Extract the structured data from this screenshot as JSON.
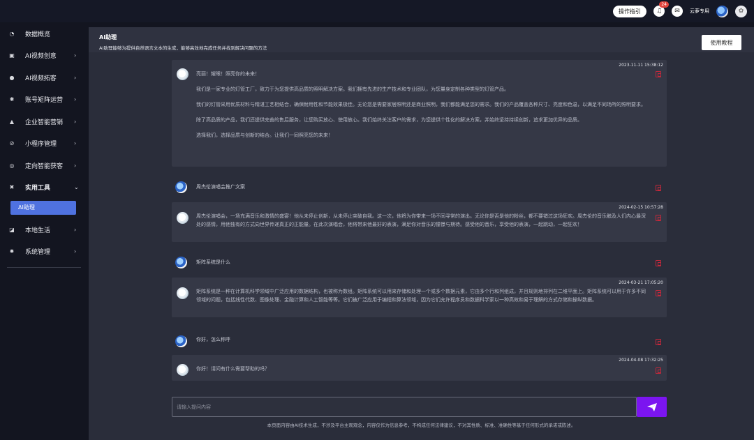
{
  "topbar": {
    "guide_label": "操作指引",
    "notification_count": "24",
    "account_label": "云萝专用"
  },
  "sidebar": {
    "items": [
      {
        "label": "数据概览",
        "icon": "dashboard-icon",
        "glyph": "◔"
      },
      {
        "label": "AI视频创意",
        "icon": "video-icon",
        "glyph": "▣"
      },
      {
        "label": "AI视频拓客",
        "icon": "target-icon",
        "glyph": "●"
      },
      {
        "label": "账号矩阵运营",
        "icon": "grid-icon",
        "glyph": "✱"
      },
      {
        "label": "企业智能营销",
        "icon": "chart-icon",
        "glyph": "▲"
      },
      {
        "label": "小程序管理",
        "icon": "miniapp-icon",
        "glyph": "⊘"
      },
      {
        "label": "定向智能获客",
        "icon": "radar-icon",
        "glyph": "◎"
      },
      {
        "label": "实用工具",
        "icon": "tools-icon",
        "glyph": "✖"
      },
      {
        "label": "本地生活",
        "icon": "local-icon",
        "glyph": "◪"
      },
      {
        "label": "系统管理",
        "icon": "settings-icon",
        "glyph": "✹"
      }
    ],
    "active_sub": "AI助理"
  },
  "header": {
    "title": "AI助理",
    "subtitle": "AI助理能够为提供自然语言文本的生成，能够高效地完成任务并找到解决问题的方法",
    "tutorial_button": "使用教程"
  },
  "chat": {
    "m1": {
      "time": "2023-11-11 15:38:12",
      "paragraphs": [
        "亮丽！耀眼！照亮你的未来！",
        "我们是一家专业的灯管工厂，致力于为您提供高品质的照明解决方案。我们拥有先进的生产技术和专业团队，为您量身定制各种类型的灯管产品。",
        "我们的灯管采用优质材料与精湛工艺相结合，确保耐用性和节能效果极佳。无论您是需要家居照明还是商业照明，我们都能满足您的需求。我们的产品覆盖各种尺寸、亮度和色温，以满足不同场所的照明要求。",
        "除了高品质的产品，我们还提供完善的售后服务，让您购买放心、使用放心。我们始终关注客户的需求，为您提供个性化的解决方案，并始终坚持持续创新，追求更加优异的品质。",
        "选择我们，选择品质与创新的结合。让我们一同照亮您的未来！"
      ]
    },
    "m2": {
      "text": "周杰伦演唱会推广文案"
    },
    "m3": {
      "time": "2024-02-15 10:57:28",
      "text": "周杰伦演唱会，一场充满音乐和激情的盛宴！他从未停止创新，从未停止突破自我。这一次，他将为你带来一场不同寻常的演出。无论你是否是他的粉丝，都不要错过这场狂欢。周杰伦的音乐触及人们内心最深处的感情，用他独有的方式向世界传递真正的正能量。在此次演唱会，他将带来他最好的表演，满足你对音乐的憧憬与期待。感受他的音乐，享受他的表演，一起跳动，一起狂欢！"
    },
    "m4": {
      "text": "矩阵系统是什么"
    },
    "m5": {
      "time": "2024-03-21 17:05:20",
      "text": "矩阵系统是一种在计算机科学领域中广泛应用的数据结构，也被称为数组。矩阵系统可以用来存储和处理一个或多个数据元素，它由多个行和列组成，并且规则地排列在二维平面上。矩阵系统可以用于许多不同领域的问题，包括线性代数、图像处理、金融计算和人工智能等等。它们被广泛应用于编程和算法领域，因为它们允许程序员和数据科学家以一种高效和易于理解的方式存储和操纵数据。"
    },
    "m6": {
      "text": "你好，怎么称呼"
    },
    "m7": {
      "time": "2024-04-08 17:32:25",
      "text": "你好！请问有什么需要帮助的吗？"
    }
  },
  "input": {
    "placeholder": "请输入提问内容"
  },
  "disclaimer": "本页面内容由AI技术生成，不涉及平台主观观念，内容仅作为信息参考，不构成任何法律建议，不对其性质、标准、准确性等基于任何形式的承诺或陈述。",
  "colors": {
    "accent": "#4f72e0",
    "send": "#7b15f0",
    "copy": "#c2283b"
  }
}
